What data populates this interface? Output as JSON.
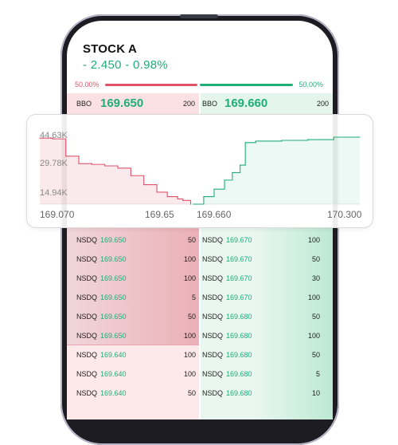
{
  "stock": {
    "name": "STOCK A",
    "change": "- 2.450 - 0.98%"
  },
  "ratio": {
    "bid_pct": "50.00%",
    "ask_pct": "50.00%"
  },
  "bbo": {
    "bid": {
      "tag": "BBO",
      "price": "169.650",
      "size": "200"
    },
    "ask": {
      "tag": "BBO",
      "price": "169.660",
      "size": "200"
    }
  },
  "book": {
    "bids": [
      {
        "exchange": "NSDQ",
        "price": "169.650",
        "size": "50"
      },
      {
        "exchange": "NSDQ",
        "price": "169.650",
        "size": "100"
      },
      {
        "exchange": "NSDQ",
        "price": "169.650",
        "size": "100"
      },
      {
        "exchange": "NSDQ",
        "price": "169.650",
        "size": "5"
      },
      {
        "exchange": "NSDQ",
        "price": "169.650",
        "size": "50"
      },
      {
        "exchange": "NSDQ",
        "price": "169.650",
        "size": "100"
      },
      {
        "exchange": "NSDQ",
        "price": "169.640",
        "size": "100"
      },
      {
        "exchange": "NSDQ",
        "price": "169.640",
        "size": "100"
      },
      {
        "exchange": "NSDQ",
        "price": "169.640",
        "size": "50"
      }
    ],
    "asks": [
      {
        "exchange": "NSDQ",
        "price": "169.670",
        "size": "100"
      },
      {
        "exchange": "NSDQ",
        "price": "169.670",
        "size": "50"
      },
      {
        "exchange": "NSDQ",
        "price": "169.670",
        "size": "30"
      },
      {
        "exchange": "NSDQ",
        "price": "169.670",
        "size": "100"
      },
      {
        "exchange": "NSDQ",
        "price": "169.680",
        "size": "50"
      },
      {
        "exchange": "NSDQ",
        "price": "169.680",
        "size": "100"
      },
      {
        "exchange": "NSDQ",
        "price": "169.680",
        "size": "50"
      },
      {
        "exchange": "NSDQ",
        "price": "169.680",
        "size": "5"
      },
      {
        "exchange": "NSDQ",
        "price": "169.680",
        "size": "10"
      }
    ]
  },
  "colors": {
    "bid": "#e0536a",
    "ask": "#1fae78"
  },
  "chart_data": {
    "type": "area",
    "y_ticks": [
      "44.63K",
      "29.78K",
      "14.94K"
    ],
    "x_ticks": [
      "169.070",
      "169.65",
      "169.660",
      "170.300"
    ],
    "ylim": [
      0,
      44630
    ],
    "xlim": [
      169.07,
      170.3
    ],
    "series": [
      {
        "side": "bid",
        "x": [
          169.07,
          169.12,
          169.17,
          169.22,
          169.27,
          169.32,
          169.37,
          169.42,
          169.47,
          169.52,
          169.56,
          169.6,
          169.62,
          169.65
        ],
        "y": [
          44000,
          43500,
          32000,
          27000,
          26500,
          25500,
          24000,
          19000,
          13000,
          8000,
          5000,
          3500,
          2500,
          0
        ]
      },
      {
        "side": "ask",
        "x": [
          169.66,
          169.7,
          169.74,
          169.78,
          169.81,
          169.84,
          169.86,
          169.9,
          170.0,
          170.1,
          170.2,
          170.25,
          170.3
        ],
        "y": [
          0,
          5000,
          10000,
          16000,
          21000,
          26000,
          41000,
          42000,
          42500,
          43000,
          45000,
          47000,
          47000
        ]
      }
    ]
  }
}
